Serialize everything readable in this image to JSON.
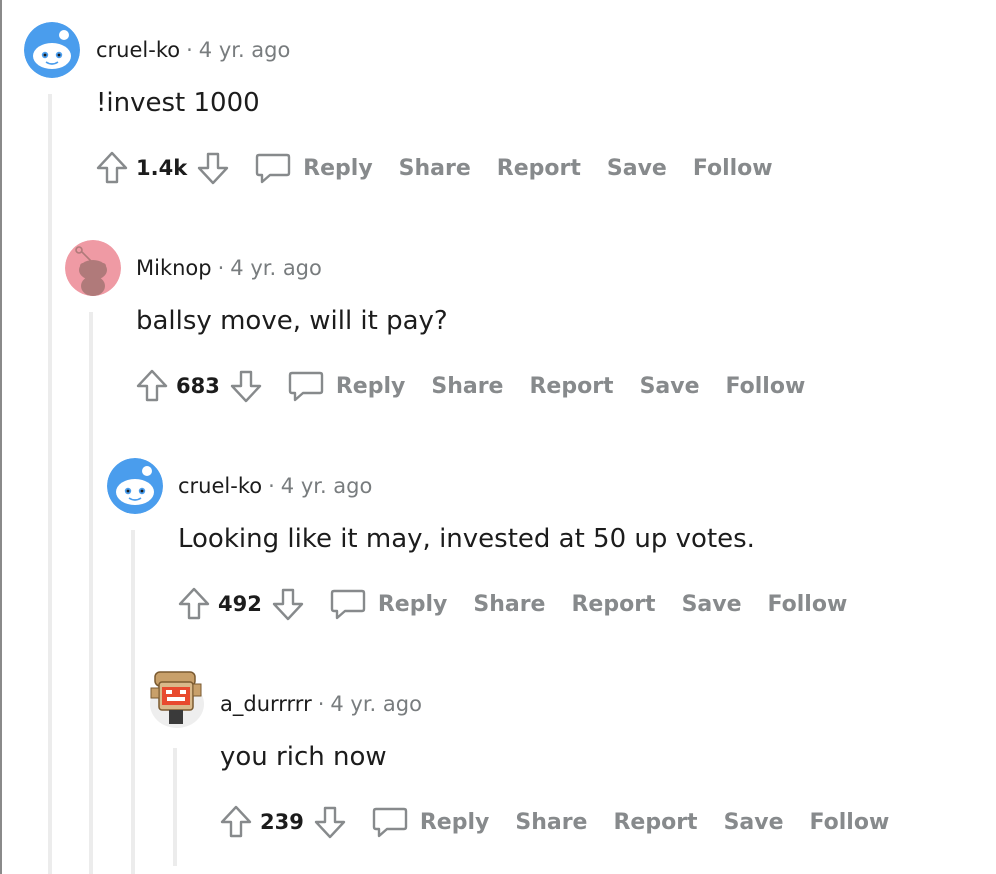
{
  "colors": {
    "thread_line": "#ececec",
    "muted": "#878a8c",
    "snoo_blue": "#4a9ded",
    "snoo_pink": "#ef9aa4"
  },
  "separator": "·",
  "comments": [
    {
      "username": "cruel-ko",
      "time": "4 yr. ago",
      "body": "!invest 1000",
      "score": "1.4k",
      "actions": {
        "reply": "Reply",
        "share": "Share",
        "report": "Report",
        "save": "Save",
        "follow": "Follow"
      },
      "avatar_icon": "blue-snoo-avatar-icon"
    },
    {
      "username": "Miknop",
      "time": "4 yr. ago",
      "body": "ballsy move, will it pay?",
      "score": "683",
      "actions": {
        "reply": "Reply",
        "share": "Share",
        "report": "Report",
        "save": "Save",
        "follow": "Follow"
      },
      "avatar_icon": "pink-snoo-avatar-icon"
    },
    {
      "username": "cruel-ko",
      "time": "4 yr. ago",
      "body": "Looking like it may, invested at 50 up votes.",
      "score": "492",
      "actions": {
        "reply": "Reply",
        "share": "Share",
        "report": "Report",
        "save": "Save",
        "follow": "Follow"
      },
      "avatar_icon": "blue-snoo-avatar-icon"
    },
    {
      "username": "a_durrrrr",
      "time": "4 yr. ago",
      "body": "you rich now",
      "score": "239",
      "actions": {
        "reply": "Reply",
        "share": "Share",
        "report": "Report",
        "save": "Save",
        "follow": "Follow"
      },
      "avatar_icon": "robot-snoo-avatar-icon"
    }
  ]
}
